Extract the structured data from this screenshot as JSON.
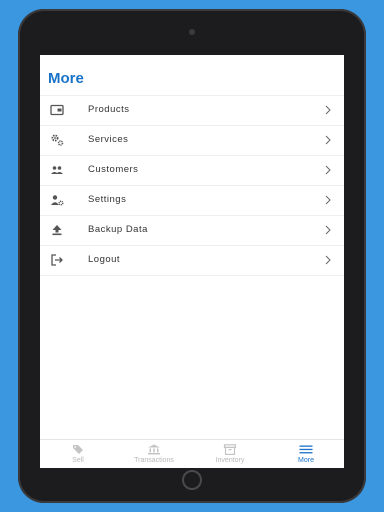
{
  "colors": {
    "background": "#3b97df",
    "accent": "#1a73c8",
    "icon": "#555555",
    "inactive": "#c4c4c4"
  },
  "page": {
    "title": "More"
  },
  "menu": [
    {
      "label": "Products",
      "icon": "wallet-icon"
    },
    {
      "label": "Services",
      "icon": "gears-icon"
    },
    {
      "label": "Customers",
      "icon": "people-icon"
    },
    {
      "label": "Settings",
      "icon": "user-gear-icon"
    },
    {
      "label": "Backup Data",
      "icon": "upload-icon"
    },
    {
      "label": "Logout",
      "icon": "logout-icon"
    }
  ],
  "tabs": [
    {
      "label": "Sell",
      "icon": "tag-icon",
      "active": false
    },
    {
      "label": "Transactions",
      "icon": "bank-icon",
      "active": false
    },
    {
      "label": "Inventory",
      "icon": "archive-box-icon",
      "active": false
    },
    {
      "label": "More",
      "icon": "menu-icon",
      "active": true
    }
  ]
}
